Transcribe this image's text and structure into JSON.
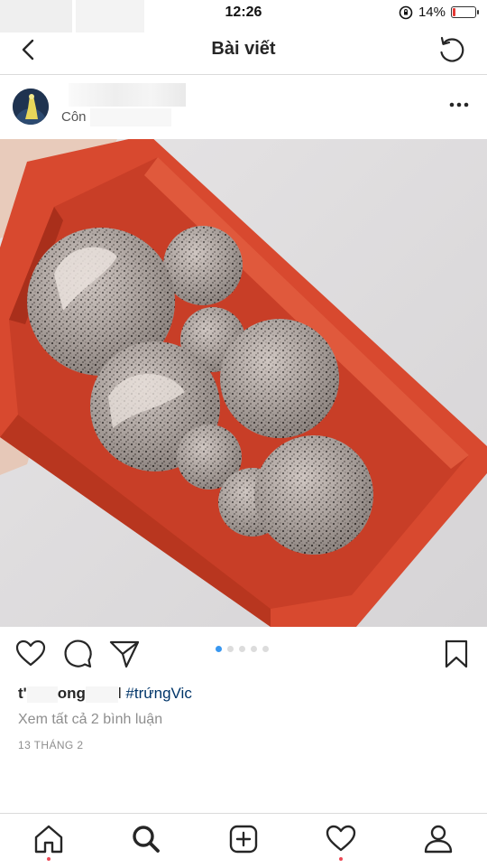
{
  "status_bar": {
    "time": "12:26",
    "battery_percent_label": "14%",
    "battery_level": 0.14
  },
  "nav": {
    "title": "Bài viết"
  },
  "post": {
    "location_prefix": "Côn",
    "caption_username_fragment_1": "t'",
    "caption_username_fragment_2": "ong",
    "caption_username_fragment_3": "l",
    "hashtag": "#trứngVic",
    "view_comments": "Xem tất cả 2 bình luận",
    "date": "13 THÁNG 2",
    "carousel": {
      "count": 5,
      "active_index": 0
    }
  },
  "icons": {
    "back": "chevron-left-icon",
    "refresh": "refresh-icon",
    "more": "more-icon",
    "like": "heart-icon",
    "comment": "comment-icon",
    "share": "send-icon",
    "save": "bookmark-icon",
    "tabs": [
      "home-icon",
      "search-icon",
      "add-icon",
      "activity-icon",
      "profile-icon"
    ]
  },
  "colors": {
    "accent_blue": "#3897f0",
    "notification_red": "#ed4956",
    "battery_red": "#e53935",
    "hashtag": "#003569"
  }
}
